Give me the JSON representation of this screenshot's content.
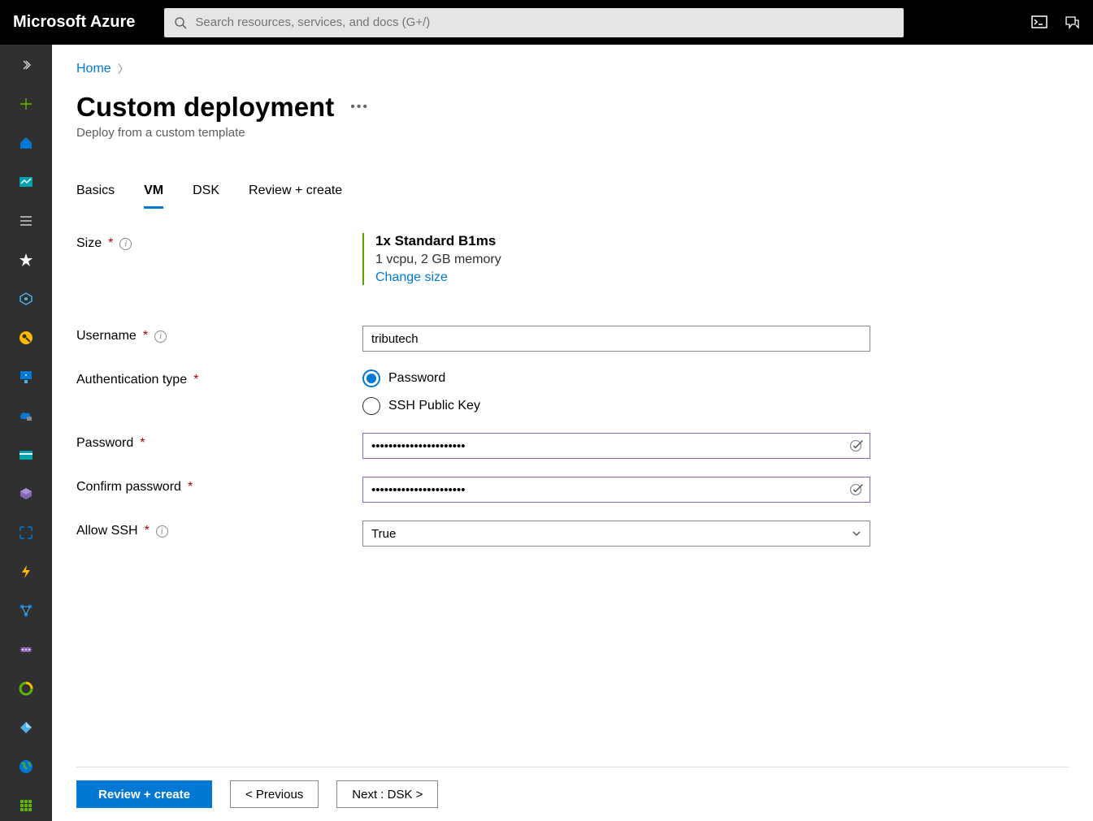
{
  "header": {
    "logo": "Microsoft Azure",
    "search_placeholder": "Search resources, services, and docs (G+/)"
  },
  "breadcrumb": {
    "home": "Home"
  },
  "page": {
    "title": "Custom deployment",
    "subtitle": "Deploy from a custom template"
  },
  "tabs": {
    "basics": "Basics",
    "vm": "VM",
    "dsk": "DSK",
    "review": "Review + create"
  },
  "form": {
    "size_label": "Size",
    "size_title": "1x Standard B1ms",
    "size_spec": "1 vcpu, 2 GB memory",
    "change_size": "Change size",
    "username_label": "Username",
    "username_value": "tributech",
    "auth_label": "Authentication type",
    "auth_password": "Password",
    "auth_ssh": "SSH Public Key",
    "password_label": "Password",
    "password_value": "••••••••••••••••••••••",
    "confirm_label": "Confirm password",
    "confirm_value": "••••••••••••••••••••••",
    "allow_ssh_label": "Allow SSH",
    "allow_ssh_value": "True"
  },
  "footer": {
    "review": "Review + create",
    "previous": "< Previous",
    "next": "Next : DSK >"
  }
}
